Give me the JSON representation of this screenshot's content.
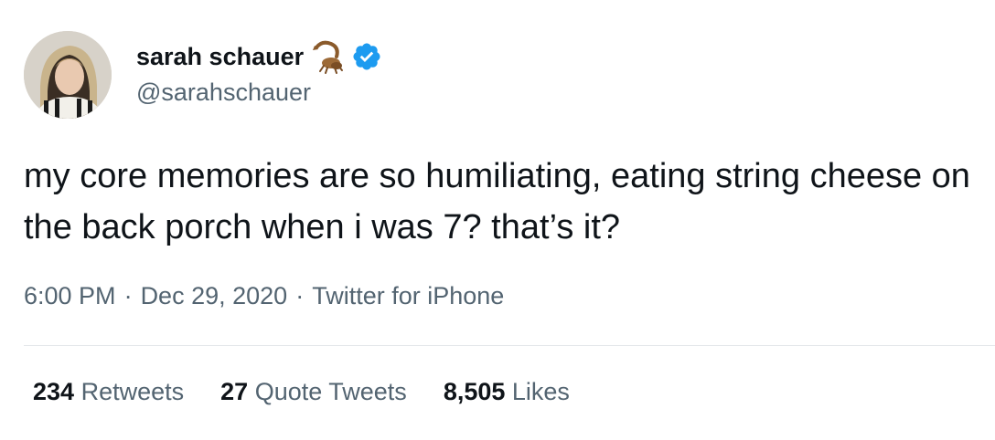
{
  "author": {
    "display_name": "sarah schauer",
    "handle": "@sarahschauer",
    "name_emoji": "scorpion-icon",
    "verified_icon": "verified-badge-icon",
    "verified_color": "#1d9bf0"
  },
  "tweet": {
    "text": "my core memories are so humiliating, eating string cheese on the back porch when i was 7? that’s it?"
  },
  "meta": {
    "time": "6:00 PM",
    "separator": "·",
    "date": "Dec 29, 2020",
    "source": "Twitter for iPhone"
  },
  "stats": {
    "retweets": {
      "count": "234",
      "label": "Retweets"
    },
    "quotes": {
      "count": "27",
      "label": "Quote Tweets"
    },
    "likes": {
      "count": "8,505",
      "label": "Likes"
    }
  },
  "colors": {
    "text_primary": "#0f1419",
    "text_secondary": "#536471",
    "divider": "#e4e8eb"
  }
}
